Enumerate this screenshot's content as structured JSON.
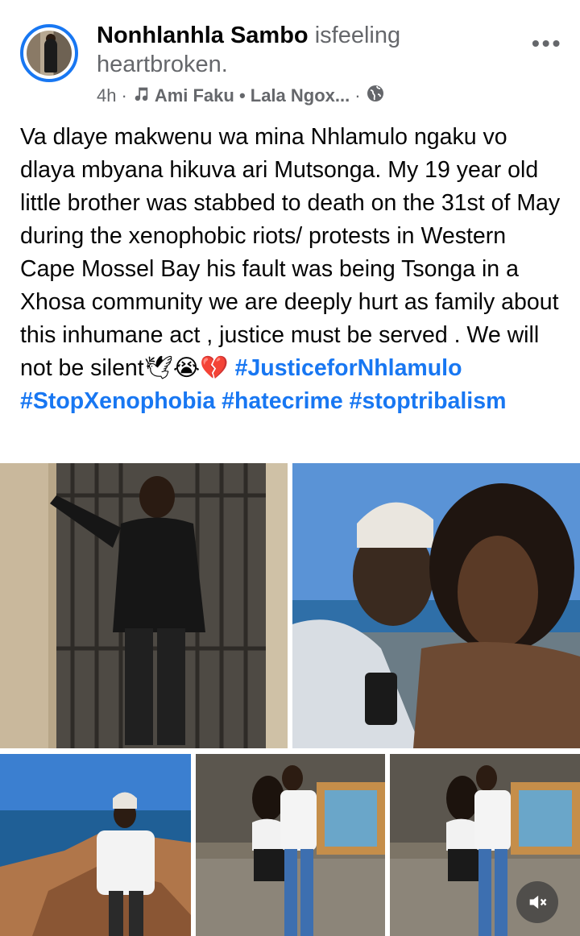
{
  "post": {
    "author": "Nonhlanhla Sambo",
    "is_word": "is",
    "feeling_word": "feeling",
    "feeling_value": "heartbroken.",
    "time": "4h",
    "song": "Ami Faku • Lala Ngox...",
    "audience_icon": "globe-icon",
    "more_icon": "more-options-icon",
    "text_main": "Va dlaye makwenu wa mina Nhlamulo ngaku vo dlaya mbyana hikuva ari Mutsonga. My 19 year old little brother was stabbed to death on the 31st of May during the xenophobic riots/ protests in Western Cape Mossel Bay his fault was being Tsonga in a Xhosa community we are deeply hurt as family about this inhumane act , justice must be served . We will not be silent",
    "emojis": "🕊😭💔",
    "hashtags": [
      "#JusticeforNhlamulo",
      "#StopXenophobia",
      "#hatecrime",
      "#stoptribalism"
    ]
  },
  "colors": {
    "accent": "#1877f2",
    "secondary_text": "#65676b"
  },
  "media": {
    "photo_count": 5,
    "mute_icon": "mute-icon"
  }
}
